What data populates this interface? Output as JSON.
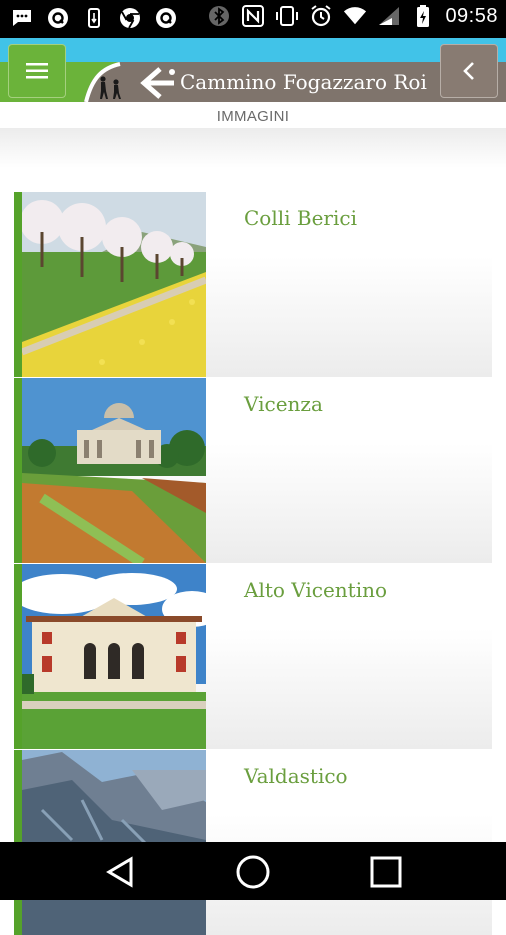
{
  "status_bar": {
    "time": "09:58",
    "left_icons": [
      "message-icon",
      "app-q-icon",
      "usb-icon",
      "chrome-icon",
      "app-q-icon"
    ],
    "right_icons": [
      "bluetooth-icon",
      "nfc-icon",
      "vibrate-icon",
      "alarm-icon",
      "wifi-icon",
      "signal-icon",
      "battery-charging-icon"
    ]
  },
  "header": {
    "app_title": "Cammino Fogazzaro Roi",
    "section_title": "IMMAGINI",
    "menu_icon": "hamburger-menu-icon",
    "back_icon": "chevron-left-icon",
    "colors": {
      "green": "#6bb33a",
      "brown": "#7f746c",
      "cyan": "#41c3e8"
    }
  },
  "gallery": {
    "items": [
      {
        "label": "Colli Berici",
        "image": "orchard-flowers-photo"
      },
      {
        "label": "Vicenza",
        "image": "villa-rotonda-photo"
      },
      {
        "label": "Alto Vicentino",
        "image": "palladian-villa-photo"
      },
      {
        "label": "Valdastico",
        "image": "mountain-valley-photo"
      }
    ]
  },
  "nav_bar": {
    "back": "nav-back-icon",
    "home": "nav-home-icon",
    "recents": "nav-recents-icon"
  }
}
